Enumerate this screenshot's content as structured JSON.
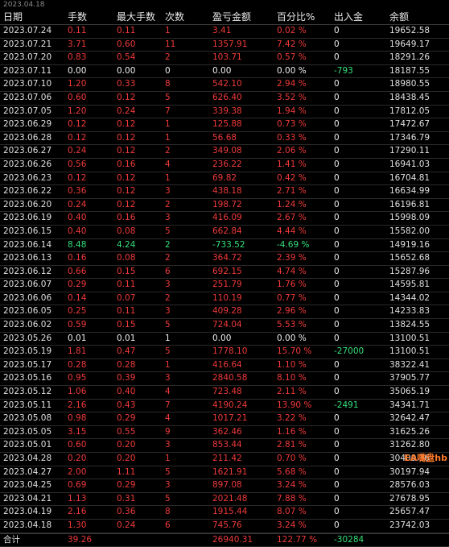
{
  "top_label": "2023.04.18",
  "columns": [
    "日期",
    "手数",
    "最大手数",
    "次数",
    "盈亏金额",
    "百分比%",
    "出入金",
    "余额"
  ],
  "colors": {
    "profit": "#f03a3a",
    "loss": "#35e07a",
    "neutral": "#f0f0f0"
  },
  "rows": [
    [
      "2023.07.24",
      "0.11",
      "0.11",
      "1",
      "3.41",
      "0.02 %",
      "0",
      "19652.58"
    ],
    [
      "2023.07.21",
      "3.71",
      "0.60",
      "11",
      "1357.91",
      "7.42 %",
      "0",
      "19649.17"
    ],
    [
      "2023.07.20",
      "0.83",
      "0.54",
      "2",
      "103.71",
      "0.57 %",
      "0",
      "18291.26"
    ],
    [
      "2023.07.11",
      "0.00",
      "0.00",
      "0",
      "0.00",
      "0.00 %",
      "-793",
      "18187.55"
    ],
    [
      "2023.07.10",
      "1.20",
      "0.33",
      "8",
      "542.10",
      "2.94 %",
      "0",
      "18980.55"
    ],
    [
      "2023.07.06",
      "0.60",
      "0.12",
      "5",
      "626.40",
      "3.52 %",
      "0",
      "18438.45"
    ],
    [
      "2023.07.05",
      "1.20",
      "0.24",
      "7",
      "339.38",
      "1.94 %",
      "0",
      "17812.05"
    ],
    [
      "2023.06.29",
      "0.12",
      "0.12",
      "1",
      "125.88",
      "0.73 %",
      "0",
      "17472.67"
    ],
    [
      "2023.06.28",
      "0.12",
      "0.12",
      "1",
      "56.68",
      "0.33 %",
      "0",
      "17346.79"
    ],
    [
      "2023.06.27",
      "0.24",
      "0.12",
      "2",
      "349.08",
      "2.06 %",
      "0",
      "17290.11"
    ],
    [
      "2023.06.26",
      "0.56",
      "0.16",
      "4",
      "236.22",
      "1.41 %",
      "0",
      "16941.03"
    ],
    [
      "2023.06.23",
      "0.12",
      "0.12",
      "1",
      "69.82",
      "0.42 %",
      "0",
      "16704.81"
    ],
    [
      "2023.06.22",
      "0.36",
      "0.12",
      "3",
      "438.18",
      "2.71 %",
      "0",
      "16634.99"
    ],
    [
      "2023.06.20",
      "0.24",
      "0.12",
      "2",
      "198.72",
      "1.24 %",
      "0",
      "16196.81"
    ],
    [
      "2023.06.19",
      "0.40",
      "0.16",
      "3",
      "416.09",
      "2.67 %",
      "0",
      "15998.09"
    ],
    [
      "2023.06.15",
      "0.40",
      "0.08",
      "5",
      "662.84",
      "4.44 %",
      "0",
      "15582.00"
    ],
    [
      "2023.06.14",
      "8.48",
      "4.24",
      "2",
      "-733.52",
      "-4.69 %",
      "0",
      "14919.16"
    ],
    [
      "2023.06.13",
      "0.16",
      "0.08",
      "2",
      "364.72",
      "2.39 %",
      "0",
      "15652.68"
    ],
    [
      "2023.06.12",
      "0.66",
      "0.15",
      "6",
      "692.15",
      "4.74 %",
      "0",
      "15287.96"
    ],
    [
      "2023.06.07",
      "0.29",
      "0.11",
      "3",
      "251.79",
      "1.76 %",
      "0",
      "14595.81"
    ],
    [
      "2023.06.06",
      "0.14",
      "0.07",
      "2",
      "110.19",
      "0.77 %",
      "0",
      "14344.02"
    ],
    [
      "2023.06.05",
      "0.25",
      "0.11",
      "3",
      "409.28",
      "2.96 %",
      "0",
      "14233.83"
    ],
    [
      "2023.06.02",
      "0.59",
      "0.15",
      "5",
      "724.04",
      "5.53 %",
      "0",
      "13824.55"
    ],
    [
      "2023.05.26",
      "0.01",
      "0.01",
      "1",
      "0.00",
      "0.00 %",
      "0",
      "13100.51"
    ],
    [
      "2023.05.19",
      "1.81",
      "0.47",
      "5",
      "1778.10",
      "15.70 %",
      "-27000",
      "13100.51"
    ],
    [
      "2023.05.17",
      "0.28",
      "0.28",
      "1",
      "416.64",
      "1.10 %",
      "0",
      "38322.41"
    ],
    [
      "2023.05.16",
      "0.95",
      "0.39",
      "3",
      "2840.58",
      "8.10 %",
      "0",
      "37905.77"
    ],
    [
      "2023.05.12",
      "1.06",
      "0.40",
      "4",
      "723.48",
      "2.11 %",
      "0",
      "35065.19"
    ],
    [
      "2023.05.11",
      "2.16",
      "0.43",
      "7",
      "4190.24",
      "13.90 %",
      "-2491",
      "34341.71"
    ],
    [
      "2023.05.08",
      "0.98",
      "0.29",
      "4",
      "1017.21",
      "3.22 %",
      "0",
      "32642.47"
    ],
    [
      "2023.05.05",
      "3.15",
      "0.55",
      "9",
      "362.46",
      "1.16 %",
      "0",
      "31625.26"
    ],
    [
      "2023.05.01",
      "0.60",
      "0.20",
      "3",
      "853.44",
      "2.81 %",
      "0",
      "31262.80"
    ],
    [
      "2023.04.28",
      "0.20",
      "0.20",
      "1",
      "211.42",
      "0.70 %",
      "0",
      "30409.36"
    ],
    [
      "2023.04.27",
      "2.00",
      "1.11",
      "5",
      "1621.91",
      "5.68 %",
      "0",
      "30197.94"
    ],
    [
      "2023.04.25",
      "0.69",
      "0.29",
      "3",
      "897.08",
      "3.24 %",
      "0",
      "28576.03"
    ],
    [
      "2023.04.21",
      "1.13",
      "0.31",
      "5",
      "2021.48",
      "7.88 %",
      "0",
      "27678.95"
    ],
    [
      "2023.04.19",
      "2.16",
      "0.36",
      "8",
      "1915.44",
      "8.07 %",
      "0",
      "25657.47"
    ],
    [
      "2023.04.18",
      "1.30",
      "0.24",
      "6",
      "745.76",
      "3.24 %",
      "0",
      "23742.03"
    ]
  ],
  "total": [
    "合计",
    "39.26",
    "",
    "",
    "26940.31",
    "122.77 %",
    "-30284",
    ""
  ],
  "watermark": "EA嘴盘hb"
}
